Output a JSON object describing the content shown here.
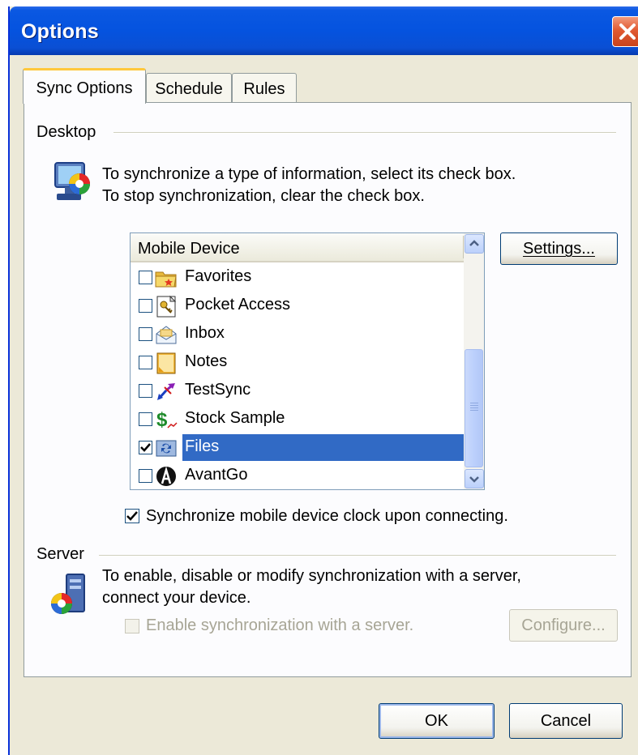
{
  "window": {
    "title": "Options"
  },
  "tabs": [
    {
      "label": "Sync Options",
      "active": true
    },
    {
      "label": "Schedule",
      "active": false
    },
    {
      "label": "Rules",
      "active": false
    }
  ],
  "desktop": {
    "group_label": "Desktop",
    "line1": "To synchronize a type of information, select its check box.",
    "line2": "To stop synchronization, clear the check box.",
    "list_header": "Mobile Device",
    "items": [
      {
        "label": "Favorites",
        "checked": false,
        "icon": "folder-favorites-icon"
      },
      {
        "label": "Pocket Access",
        "checked": false,
        "icon": "pocket-access-icon"
      },
      {
        "label": "Inbox",
        "checked": false,
        "icon": "inbox-icon"
      },
      {
        "label": "Notes",
        "checked": false,
        "icon": "notes-icon"
      },
      {
        "label": "TestSync",
        "checked": false,
        "icon": "testsync-arrows-icon"
      },
      {
        "label": "Stock Sample",
        "checked": false,
        "icon": "dollar-icon"
      },
      {
        "label": "Files",
        "checked": true,
        "selected": true,
        "icon": "files-sync-icon"
      },
      {
        "label": "AvantGo",
        "checked": false,
        "icon": "avantgo-icon"
      }
    ],
    "settings_label": "Settings...",
    "clock_checkbox_label": "Synchronize mobile device clock upon connecting.",
    "clock_checked": true
  },
  "server": {
    "group_label": "Server",
    "line1": "To enable, disable or modify synchronization with a server,",
    "line2": "connect your device.",
    "enable_label": "Enable synchronization with a server.",
    "enable_checked": false,
    "configure_label": "Configure..."
  },
  "footer": {
    "ok_label": "OK",
    "cancel_label": "Cancel"
  },
  "colors": {
    "title_bar": "#0553df",
    "selection": "#316ac5",
    "close": "#e15a31",
    "face": "#ece9d8"
  }
}
